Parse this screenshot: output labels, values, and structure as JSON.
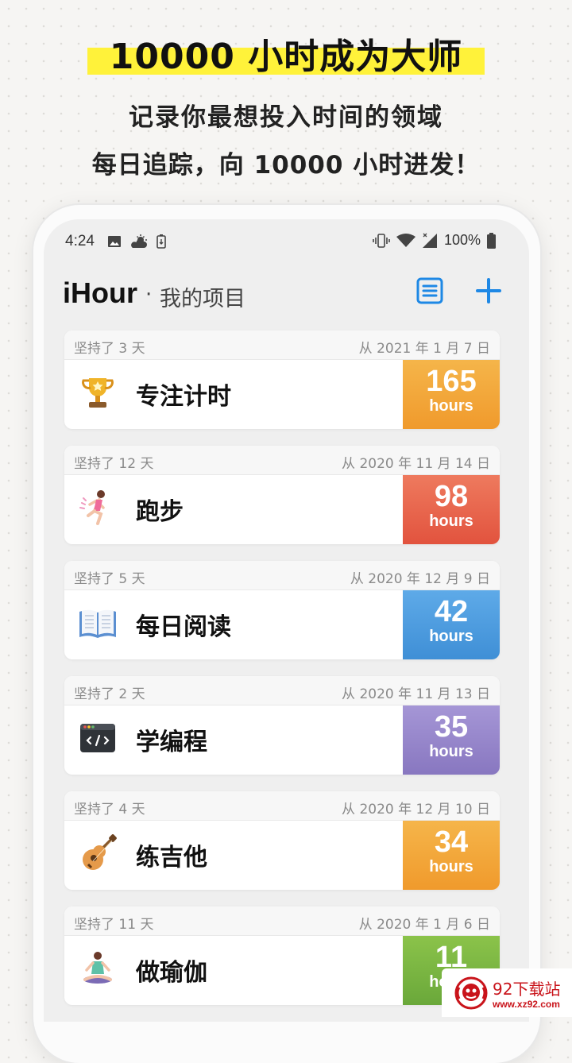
{
  "promo": {
    "headline": "10000 小时成为大师",
    "line1": "记录你最想投入时间的领域",
    "line2": "每日追踪，向 10000 小时进发！",
    "highlight_color": "#fff23a"
  },
  "status_bar": {
    "time": "4:24",
    "left_icons": [
      "image-icon",
      "weather-icon",
      "battery-saver-icon"
    ],
    "right_icons": [
      "vibrate-icon",
      "wifi-icon",
      "signal-icon",
      "battery-icon"
    ],
    "battery": "100%"
  },
  "app_bar": {
    "title": "iHour",
    "separator": "·",
    "subtitle": "我的项目",
    "accent_color": "#1e88e5"
  },
  "projects": [
    {
      "persist": "坚持了 3 天",
      "since": "从 2021 年 1 月 7 日",
      "name": "专注计时",
      "icon": "trophy-icon",
      "hours": "165",
      "unit": "hours",
      "color": "#f2a93b"
    },
    {
      "persist": "坚持了 12 天",
      "since": "从 2020 年 11 月 14 日",
      "name": "跑步",
      "icon": "runner-icon",
      "hours": "98",
      "unit": "hours",
      "color": "#e5634d"
    },
    {
      "persist": "坚持了 5 天",
      "since": "从 2020 年 12 月 9 日",
      "name": "每日阅读",
      "icon": "book-icon",
      "hours": "42",
      "unit": "hours",
      "color": "#4f9fe0"
    },
    {
      "persist": "坚持了 2 天",
      "since": "从 2020 年 11 月 13 日",
      "name": "学编程",
      "icon": "code-window-icon",
      "hours": "35",
      "unit": "hours",
      "color": "#9585c9"
    },
    {
      "persist": "坚持了 4 天",
      "since": "从 2020 年 12 月 10 日",
      "name": "练吉他",
      "icon": "guitar-icon",
      "hours": "34",
      "unit": "hours",
      "color": "#f2a93b"
    },
    {
      "persist": "坚持了 11 天",
      "since": "从 2020 年 1 月 6 日",
      "name": "做瑜伽",
      "icon": "yoga-icon",
      "hours": "11",
      "unit": "hours",
      "color": "#7cb342"
    }
  ],
  "watermark": {
    "text": "92下载站",
    "url": "www.xz92.com"
  }
}
